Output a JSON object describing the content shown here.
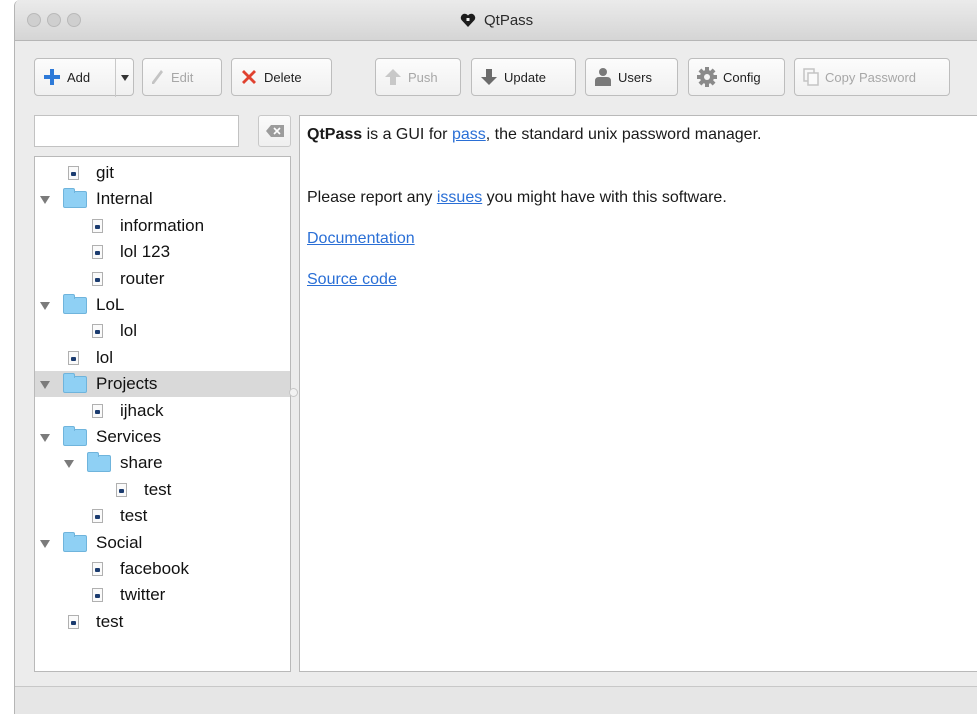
{
  "window": {
    "title": "QtPass"
  },
  "toolbar": {
    "add": "Add",
    "edit": "Edit",
    "delete": "Delete",
    "push": "Push",
    "update": "Update",
    "users": "Users",
    "config": "Config",
    "copy_password": "Copy Password"
  },
  "search": {
    "value": "",
    "placeholder": ""
  },
  "tree": [
    {
      "label": "git",
      "type": "file",
      "depth": 0
    },
    {
      "label": "Internal",
      "type": "folder",
      "depth": 0,
      "expanded": true
    },
    {
      "label": "information",
      "type": "file",
      "depth": 1
    },
    {
      "label": "lol 123",
      "type": "file",
      "depth": 1
    },
    {
      "label": "router",
      "type": "file",
      "depth": 1
    },
    {
      "label": "LoL",
      "type": "folder",
      "depth": 0,
      "expanded": true
    },
    {
      "label": "lol",
      "type": "file",
      "depth": 1
    },
    {
      "label": "lol",
      "type": "file",
      "depth": 0
    },
    {
      "label": "Projects",
      "type": "folder",
      "depth": 0,
      "expanded": true,
      "selected": true
    },
    {
      "label": "ijhack",
      "type": "file",
      "depth": 1
    },
    {
      "label": "Services",
      "type": "folder",
      "depth": 0,
      "expanded": true
    },
    {
      "label": "share",
      "type": "folder",
      "depth": 1,
      "expanded": true
    },
    {
      "label": "test",
      "type": "file",
      "depth": 2
    },
    {
      "label": "test",
      "type": "file",
      "depth": 1
    },
    {
      "label": "Social",
      "type": "folder",
      "depth": 0,
      "expanded": true
    },
    {
      "label": "facebook",
      "type": "file",
      "depth": 1
    },
    {
      "label": "twitter",
      "type": "file",
      "depth": 1
    },
    {
      "label": "test",
      "type": "file",
      "depth": 0
    }
  ],
  "content": {
    "line1_bold": "QtPass",
    "line1_a": " is a GUI for ",
    "line1_link": "pass",
    "line1_b": ", the standard unix password manager.",
    "line2_a": "Please report any ",
    "line2_link": "issues",
    "line2_b": " you might have with this software.",
    "documentation": "Documentation",
    "source_code": "Source code"
  },
  "colors": {
    "link": "#2a6fd6",
    "folder": "#8fd0f4",
    "selection": "#d9d9d9",
    "delete_icon": "#e0412f",
    "add_icon": "#2e7ad8"
  }
}
